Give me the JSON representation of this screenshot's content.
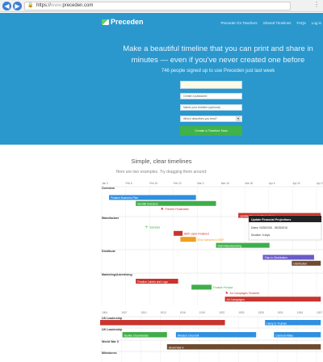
{
  "browser": {
    "scheme": "https://",
    "url_faint": "www.",
    "url_domain": "preceden.com"
  },
  "nav": {
    "logo": "Preceden",
    "links": [
      "Preceden for Teachers",
      "Shared Timelines",
      "FAQs",
      "Log in"
    ]
  },
  "hero": {
    "title": "Make a beautiful timeline that you can print and share in minutes — even if you've never created one before",
    "signup_count": "746 people signed up to use Preceden just last week"
  },
  "form": {
    "email_placeholder": "",
    "password_placeholder": "Create a password",
    "title_placeholder": "Name your timeline (optional)",
    "describe_placeholder": "Which describes you best?",
    "submit_label": "Create a Timeline Now"
  },
  "section2": {
    "title": "Simple, clear timelines",
    "subtitle": "Here are two examples. Try dragging them around:"
  },
  "timeline1": {
    "ticks": [
      "Jan 3",
      "Feb 6",
      "Feb 19",
      "Feb 23",
      "Mar 3",
      "Mar 16",
      "Mar 30",
      "Apr 6",
      "Apr 20",
      "Apr 27"
    ],
    "layers": [
      "Overview",
      "Manufacture",
      "Distribute",
      "Marketing/Advertising"
    ],
    "colors": {
      "blue": "#2f8fe0",
      "green": "#3fae49",
      "red": "#c8342e",
      "orange": "#f0a020",
      "purple": "#6b5bc8",
      "brown": "#6e4a2f",
      "grey": "#888888"
    },
    "events": [
      {
        "label": "Finalize Business Plan",
        "start": 0.04,
        "end": 0.43,
        "row": 1,
        "color": "blue"
      },
      {
        "label": "Identify Investors",
        "start": 0.16,
        "end": 0.52,
        "row": 2,
        "color": "green"
      },
      {
        "label": "Prevent Finalization",
        "start": 0.27,
        "end": 0.27,
        "row": 3,
        "color": "red",
        "type": "milestone"
      },
      {
        "label": "Update Financial Projections",
        "start": 0.62,
        "end": 0.99,
        "row": 4,
        "color": "red"
      },
      {
        "label": "Samples",
        "start": 0.2,
        "end": 0.2,
        "row": 6,
        "color": "green",
        "type": "milestone"
      },
      {
        "label": "BBP Label Finalized",
        "start": 0.33,
        "end": 0.37,
        "row": 7,
        "color": "red"
      },
      {
        "label": "Ship Samples to BBP",
        "start": 0.36,
        "end": 0.43,
        "row": 8,
        "color": "orange"
      },
      {
        "label": "Start Manufacturing",
        "start": 0.52,
        "end": 0.76,
        "row": 9,
        "color": "green"
      },
      {
        "label": "Ship to Distribution",
        "start": 0.73,
        "end": 0.96,
        "row": 11,
        "color": "purple"
      },
      {
        "label": "Distribution",
        "start": 0.86,
        "end": 0.99,
        "row": 12,
        "color": "brown"
      },
      {
        "label": "Finalize Labels and Logo",
        "start": 0.16,
        "end": 0.35,
        "row": 15,
        "color": "red"
      },
      {
        "label": "Finalize Product",
        "start": 0.41,
        "end": 0.5,
        "row": 16,
        "color": "green"
      },
      {
        "label": "Ad Campaigns Finalized",
        "start": 0.56,
        "end": 0.56,
        "row": 17,
        "color": "red",
        "type": "milestone"
      },
      {
        "label": "Ad Campaigns",
        "start": 0.56,
        "end": 0.99,
        "row": 18,
        "color": "red"
      }
    ],
    "tooltip": {
      "title": "Update Financial Projections",
      "dates": "Dates: 03/28/2016 - 05/28/2016",
      "duration": "Duration: 6 days"
    }
  },
  "timeline2": {
    "ticks": [
      "1904",
      "1907",
      "1910",
      "1913",
      "1916",
      "1919",
      "1922",
      "1925",
      "1928",
      "1931",
      "1934",
      "1937"
    ],
    "layers": [
      "US Leadership",
      "UK Leadership",
      "World War II",
      "Milestones"
    ],
    "events": [
      {
        "label": "",
        "start": 0.0,
        "end": 0.56,
        "row": 0,
        "color": "red"
      },
      {
        "label": "Harry S. Truman",
        "start": 0.74,
        "end": 0.99,
        "row": 0,
        "color": "blue"
      },
      {
        "label": "Neville Chamberlain",
        "start": 0.1,
        "end": 0.3,
        "row": 2,
        "color": "green"
      },
      {
        "label": "Winston Churchill",
        "start": 0.34,
        "end": 0.7,
        "row": 2,
        "color": "blue"
      },
      {
        "label": "Clement Attlee",
        "start": 0.78,
        "end": 0.99,
        "row": 2,
        "color": "blue"
      },
      {
        "label": "World War II",
        "start": 0.3,
        "end": 0.99,
        "row": 4,
        "color": "brown"
      }
    ]
  }
}
